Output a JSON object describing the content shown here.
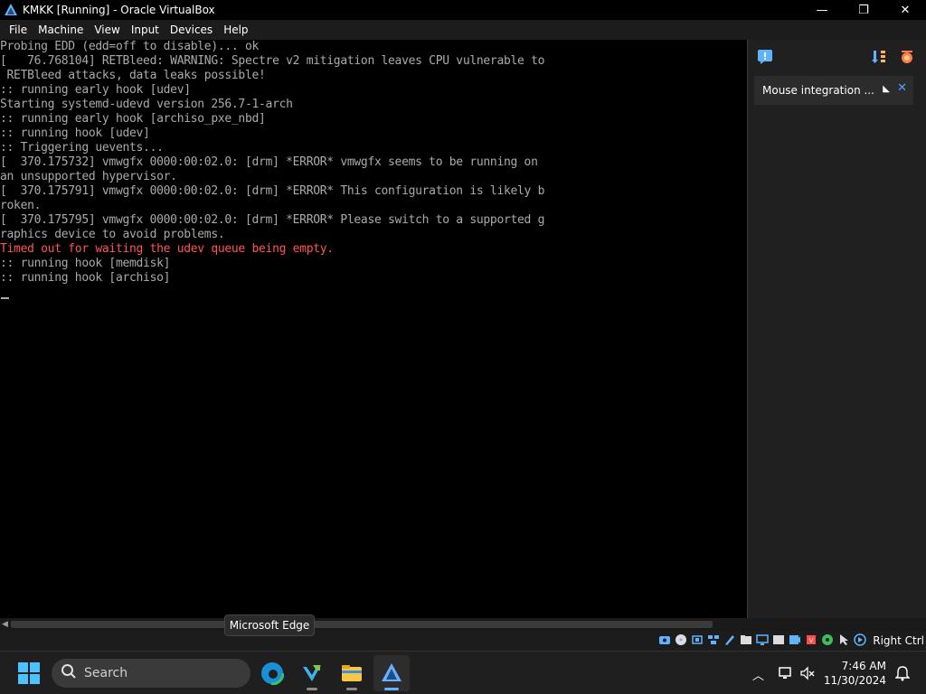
{
  "window": {
    "title": "KMKK [Running] - Oracle VirtualBox",
    "minimize": "—",
    "maximize": "❐",
    "close": "✕"
  },
  "menu": [
    "File",
    "Machine",
    "View",
    "Input",
    "Devices",
    "Help"
  ],
  "console": {
    "lines": [
      {
        "text": "Probing EDD (edd=off to disable)... ok",
        "error": false
      },
      {
        "text": "[   76.768104] RETBleed: WARNING: Spectre v2 mitigation leaves CPU vulnerable to",
        "error": false
      },
      {
        "text": " RETBleed attacks, data leaks possible!",
        "error": false
      },
      {
        "text": ":: running early hook [udev]",
        "error": false
      },
      {
        "text": "Starting systemd-udevd version 256.7-1-arch",
        "error": false
      },
      {
        "text": ":: running early hook [archiso_pxe_nbd]",
        "error": false
      },
      {
        "text": ":: running hook [udev]",
        "error": false
      },
      {
        "text": ":: Triggering uevents...",
        "error": false
      },
      {
        "text": "[  370.175732] vmwgfx 0000:00:02.0: [drm] *ERROR* vmwgfx seems to be running on",
        "error": false
      },
      {
        "text": "an unsupported hypervisor.",
        "error": false
      },
      {
        "text": "[  370.175791] vmwgfx 0000:00:02.0: [drm] *ERROR* This configuration is likely b",
        "error": false
      },
      {
        "text": "roken.",
        "error": false
      },
      {
        "text": "[  370.175795] vmwgfx 0000:00:02.0: [drm] *ERROR* Please switch to a supported g",
        "error": false
      },
      {
        "text": "raphics device to avoid problems.",
        "error": false
      },
      {
        "text": "Timed out for waiting the udev queue being empty.",
        "error": true
      },
      {
        "text": ":: running hook [memdisk]",
        "error": false
      },
      {
        "text": ":: running hook [archiso]",
        "error": false
      }
    ]
  },
  "sidepanel": {
    "notification": "Mouse integration ..."
  },
  "statusbar": {
    "host_key": "Right Ctrl"
  },
  "tooltip": "Microsoft Edge",
  "taskbar": {
    "search_placeholder": "Search",
    "apps": [
      "microsoft-edge",
      "visual-studio",
      "file-explorer",
      "virtualbox"
    ],
    "time": "7:46 AM",
    "date": "11/30/2024"
  },
  "colors": {
    "console_text": "#aaaaaa",
    "console_error": "#ff5555",
    "accent": "#5fb3ff"
  }
}
